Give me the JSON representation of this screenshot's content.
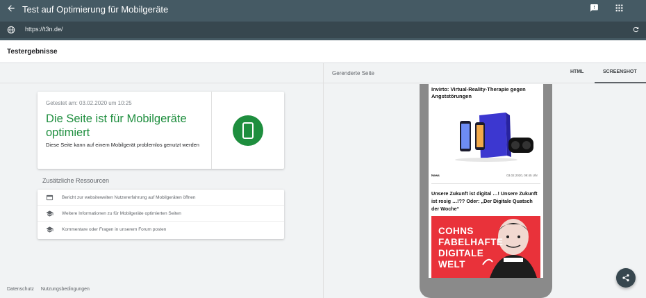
{
  "header": {
    "title": "Test auf Optimierung für Mobilgeräte",
    "url": "https://t3n.de/"
  },
  "results": {
    "label": "Testergebnisse",
    "tested_at": "Getestet am: 03.02.2020 um 10:25",
    "headline": "Die Seite ist für Mobilgeräte optimiert",
    "description": "Diese Seite kann auf einem Mobilgerät problemlos genutzt werden",
    "accent_color": "#1e8e3e"
  },
  "resources": {
    "heading": "Zusätzliche Ressourcen",
    "items": [
      {
        "icon": "browser-window-icon",
        "label": "Bericht zur websiteweiten Nutzererfahrung auf Mobilgeräten öffnen"
      },
      {
        "icon": "graduation-cap-icon",
        "label": "Weitere Informationen zu für Mobilgeräte optimierten Seiten"
      },
      {
        "icon": "graduation-cap-icon",
        "label": "Kommentare oder Fragen in unserem Forum posten"
      }
    ]
  },
  "footer": {
    "links": [
      "Datenschutz",
      "Nutzungsbedingungen"
    ]
  },
  "rendered": {
    "label": "Gerenderte Seite",
    "tabs": [
      "HTML",
      "SCREENSHOT"
    ],
    "active_tab": "SCREENSHOT"
  },
  "preview": {
    "article1": {
      "title": "Invirto: Virtual-Reality-Therapie gegen Angststörungen",
      "category": "News",
      "date": "03.02.2020, 09:45 Uhr"
    },
    "article2": {
      "title": "Unsere Zukunft ist digital …! Unsere Zukunft ist rosig …!?? Oder: „Der Digitale Quatsch der Woche“",
      "image_text": [
        "COHNS",
        "FABELHAFTE",
        "DIGITALE",
        "WELT"
      ]
    }
  },
  "colors": {
    "toolbar": "#455a64",
    "urlbar": "#37474f"
  }
}
